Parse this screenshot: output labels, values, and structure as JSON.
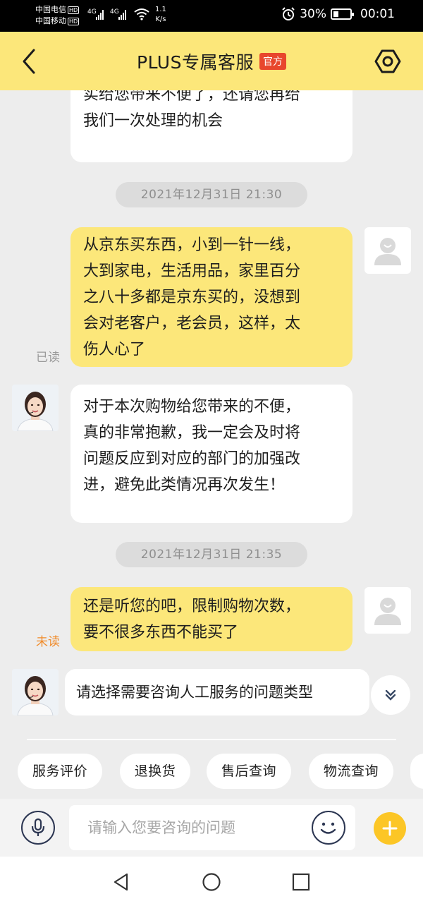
{
  "status_bar": {
    "carrier1": "中国电信",
    "carrier2": "中国移动",
    "hd": "HD",
    "net1": "4G",
    "net2": "4G",
    "speed_value": "1.1",
    "speed_unit": "K/s",
    "battery_percent": "30%",
    "battery_level": 0.3,
    "time": "00:01"
  },
  "header": {
    "title": "PLUS专属客服",
    "badge": "官方"
  },
  "messages": {
    "m1_line1": "实给您带来不便了，还请您再给",
    "m1_line2": "我们一次处理的机会",
    "time1": "2021年12月31日  21:30",
    "m2_lines": [
      "从京东买东西，小到一针一线，",
      "大到家电，生活用品，家里百分",
      "之八十多都是京东买的，没想到",
      "会对老客户，老会员，这样，太",
      "伤人心了"
    ],
    "m2_status": "已读",
    "m3_lines": [
      "对于本次购物给您带来的不便，",
      "真的非常抱歉，我一定会及时将",
      "问题反应到对应的部门的加强改",
      "进，避免此类情况再次发生！"
    ],
    "time2": "2021年12月31日  21:35",
    "m4_lines": [
      "还是听您的吧，限制购物次数，",
      "要不很多东西不能买了"
    ],
    "m4_status": "未读",
    "m5": "请选择需要咨询人工服务的问题类型"
  },
  "quick_replies": [
    "服务评价",
    "退换货",
    "售后查询",
    "物流查询"
  ],
  "input": {
    "placeholder": "请输入您要咨询的问题"
  },
  "colors": {
    "accent_yellow": "#fce77a",
    "badge_red": "#e8472d",
    "plus_yellow": "#fcc626",
    "unread_orange": "#f08b2a"
  }
}
